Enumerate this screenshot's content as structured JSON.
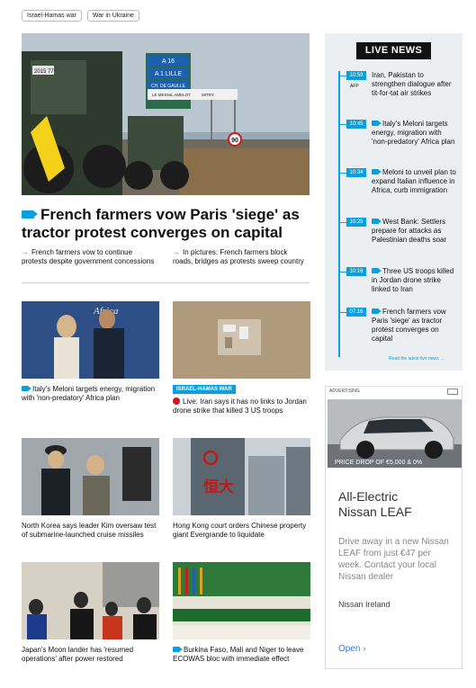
{
  "tags": [
    "Israel-Hamas war",
    "War in Ukraine"
  ],
  "hero": {
    "title": "French farmers vow Paris 'siege' as tractor protest converges on capital",
    "related": [
      "French farmers vow to continue protests despite government concessions",
      "In pictures: French farmers block roads, bridges as protests sweep country"
    ],
    "signs": {
      "a16": "A 16",
      "lille": "A 1 LILLE",
      "cdg": "CH. DE GAULLE",
      "exit_a": "LE MESNIL AMELOT",
      "exit_b": "MITRY",
      "speed": "90",
      "plate": "2015 77"
    }
  },
  "cards": [
    {
      "caption": "Italy's Meloni targets energy, migration with 'non-predatory' Africa plan",
      "video": true,
      "img_text": "Africa"
    },
    {
      "caption": "Live: Iran says it has no links to Jordan drone strike that killed 3 US troops",
      "badge": "ISRAEL-HAMAS WAR",
      "live": true
    },
    {
      "caption": "North Korea says leader Kim oversaw test of submarine-launched cruise missiles"
    },
    {
      "caption": "Hong Kong court orders Chinese property giant Evergrande to liquidate",
      "img_text": "恒大"
    },
    {
      "caption": "Japan's Moon lander has 'resumed operations' after power restored"
    },
    {
      "caption": "Burkina Faso, Mali and Niger to leave ECOWAS bloc with immediate effect",
      "video": true
    }
  ],
  "live_news": {
    "heading": "LIVE NEWS",
    "items": [
      {
        "time": "10:59",
        "source": "AFP",
        "text": "Iran, Pakistan to strengthen dialogue after tit-for-tat air strikes",
        "video": false
      },
      {
        "time": "10:45",
        "text": "Italy's Meloni targets energy, migration with 'non-predatory' Africa plan",
        "video": true
      },
      {
        "time": "10:34",
        "text": "Meloni to unveil plan to expand Italian influence in Africa, curb immigration",
        "video": true
      },
      {
        "time": "10:25",
        "text": "West Bank: Settlers prepare for attacks as Palestinian deaths soar",
        "video": true
      },
      {
        "time": "10:16",
        "text": "Three US troops killed in Jordan drone strike linked to Iran",
        "video": true
      },
      {
        "time": "07:16",
        "text": "French farmers vow Paris 'siege' as tractor protest converges on capital",
        "video": true
      }
    ],
    "more": "Read the latest live news →"
  },
  "ad": {
    "label": "ADVERTISING",
    "price": "PRICE DROP OF €5,000 & 0% FINANCE",
    "title": "All-Electric Nissan LEAF",
    "body": "Drive away in a new Nissan LEAF from just €47 per week. Contact your local Nissan dealer",
    "advertiser": "Nissan Ireland",
    "cta": "Open",
    "cta_icon": "chevron-right-icon"
  },
  "colors": {
    "accent": "#0aa0e0",
    "live_dot": "#d01818",
    "ad_link": "#2b7de9"
  }
}
